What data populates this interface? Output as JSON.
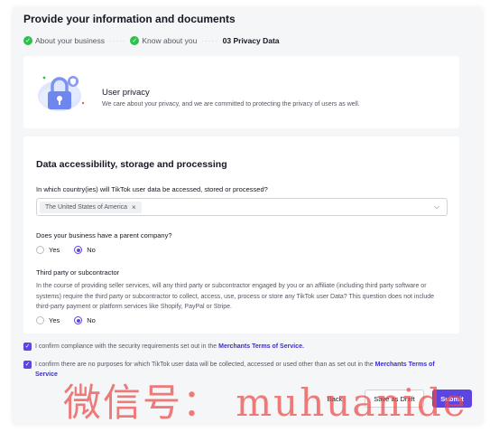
{
  "page": {
    "title": "Provide your information and documents"
  },
  "steps": [
    {
      "label": "About your business",
      "status": "done"
    },
    {
      "label": "Know about you",
      "status": "done"
    },
    {
      "label": "03 Privacy Data",
      "status": "active"
    }
  ],
  "privacy_card": {
    "title": "User privacy",
    "description": "We care about your privacy, and we are committed to protecting the privacy of users as well."
  },
  "data_section": {
    "title": "Data accessibility, storage and processing",
    "q_country": "In which country(ies) will TikTok user data be accessed, stored or processed?",
    "country_tag": "The United States of America",
    "q_parent": "Does your business have a parent company?",
    "parent_yes": "Yes",
    "parent_no": "No",
    "parent_selected": "No",
    "q_third_party": "Third party or subcontractor",
    "third_party_text": "In the course of providing seller services, will any third party or subcontractor engaged by you or an affiliate (including third party software or systems) require the third party or subcontractor to collect, access, use, process or store any TikTok user Data? This question does not include third-party payment or platform services like Shopify, PayPal or Stripe.",
    "third_yes": "Yes",
    "third_no": "No",
    "third_selected": "No"
  },
  "confirmations": {
    "c1_text": "I confirm compliance with the security requirements set out in the",
    "c1_link": "Merchants Terms of Service.",
    "c2_text": "I confirm there are no purposes for which TikTok user data will be collected, accessed or used other than as set out in the",
    "c2_link": "Merchants Terms of Service"
  },
  "footer": {
    "back": "Back",
    "save_draft": "Save as Draft",
    "submit": "Submit"
  },
  "watermark": "微信号： muhuanide",
  "colors": {
    "accent": "#5c45e0",
    "success": "#2fbf4e",
    "link": "#3b2fc8"
  }
}
